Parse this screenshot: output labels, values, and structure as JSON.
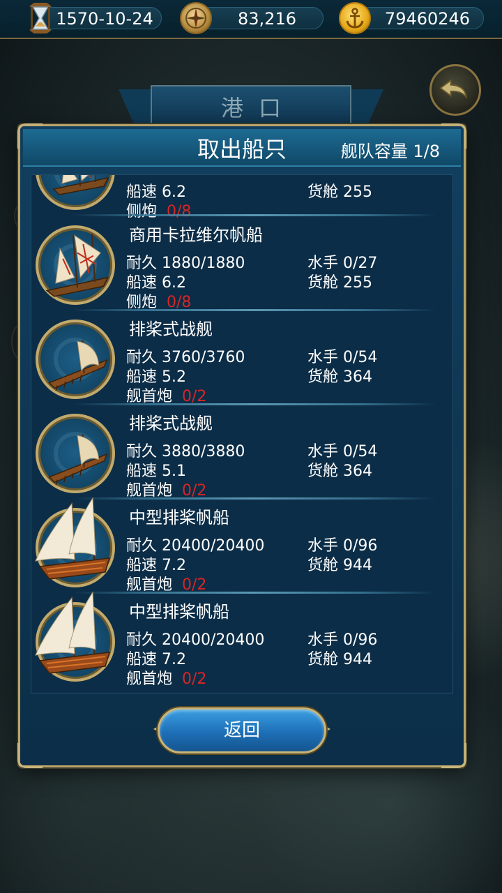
{
  "topbar": {
    "date": "1570-10-24",
    "compass_value": "83,216",
    "gold_value": "79460246"
  },
  "port": {
    "title": "港口"
  },
  "dialog": {
    "title": "取出船只",
    "fleet_capacity": "舰队容量 1/8",
    "return_label": "返回"
  },
  "ships": [
    {
      "name": "",
      "durability": "",
      "sailors": "",
      "speed": "船速 6.2",
      "cargo": "货舱    255",
      "cannon_label": "侧炮",
      "cannon_value": "0/8",
      "icon": "caravel-icon"
    },
    {
      "name": "商用卡拉维尔帆船",
      "durability": "耐久 1880/1880",
      "sailors": "水手 0/27",
      "speed": "船速 6.2",
      "cargo": "货舱    255",
      "cannon_label": "侧炮",
      "cannon_value": "0/8",
      "icon": "caravel-icon"
    },
    {
      "name": "排桨式战舰",
      "durability": "耐久 3760/3760",
      "sailors": "水手 0/54",
      "speed": "船速 5.2",
      "cargo": "货舱    364",
      "cannon_label": "舰首炮",
      "cannon_value": "0/2",
      "icon": "galley-icon"
    },
    {
      "name": "排桨式战舰",
      "durability": "耐久 3880/3880",
      "sailors": "水手 0/54",
      "speed": "船速 5.1",
      "cargo": "货舱    364",
      "cannon_label": "舰首炮",
      "cannon_value": "0/2",
      "icon": "galley-icon"
    },
    {
      "name": "中型排桨帆船",
      "durability": "耐久 20400/20400",
      "sailors": "水手 0/96",
      "speed": "船速 7.2",
      "cargo": "货舱    944",
      "cannon_label": "舰首炮",
      "cannon_value": "0/2",
      "icon": "galleass-icon"
    },
    {
      "name": "中型排桨帆船",
      "durability": "耐久 20400/20400",
      "sailors": "水手 0/96",
      "speed": "船速 7.2",
      "cargo": "货舱    944",
      "cannon_label": "舰首炮",
      "cannon_value": "0/2",
      "icon": "galleass-icon"
    }
  ]
}
